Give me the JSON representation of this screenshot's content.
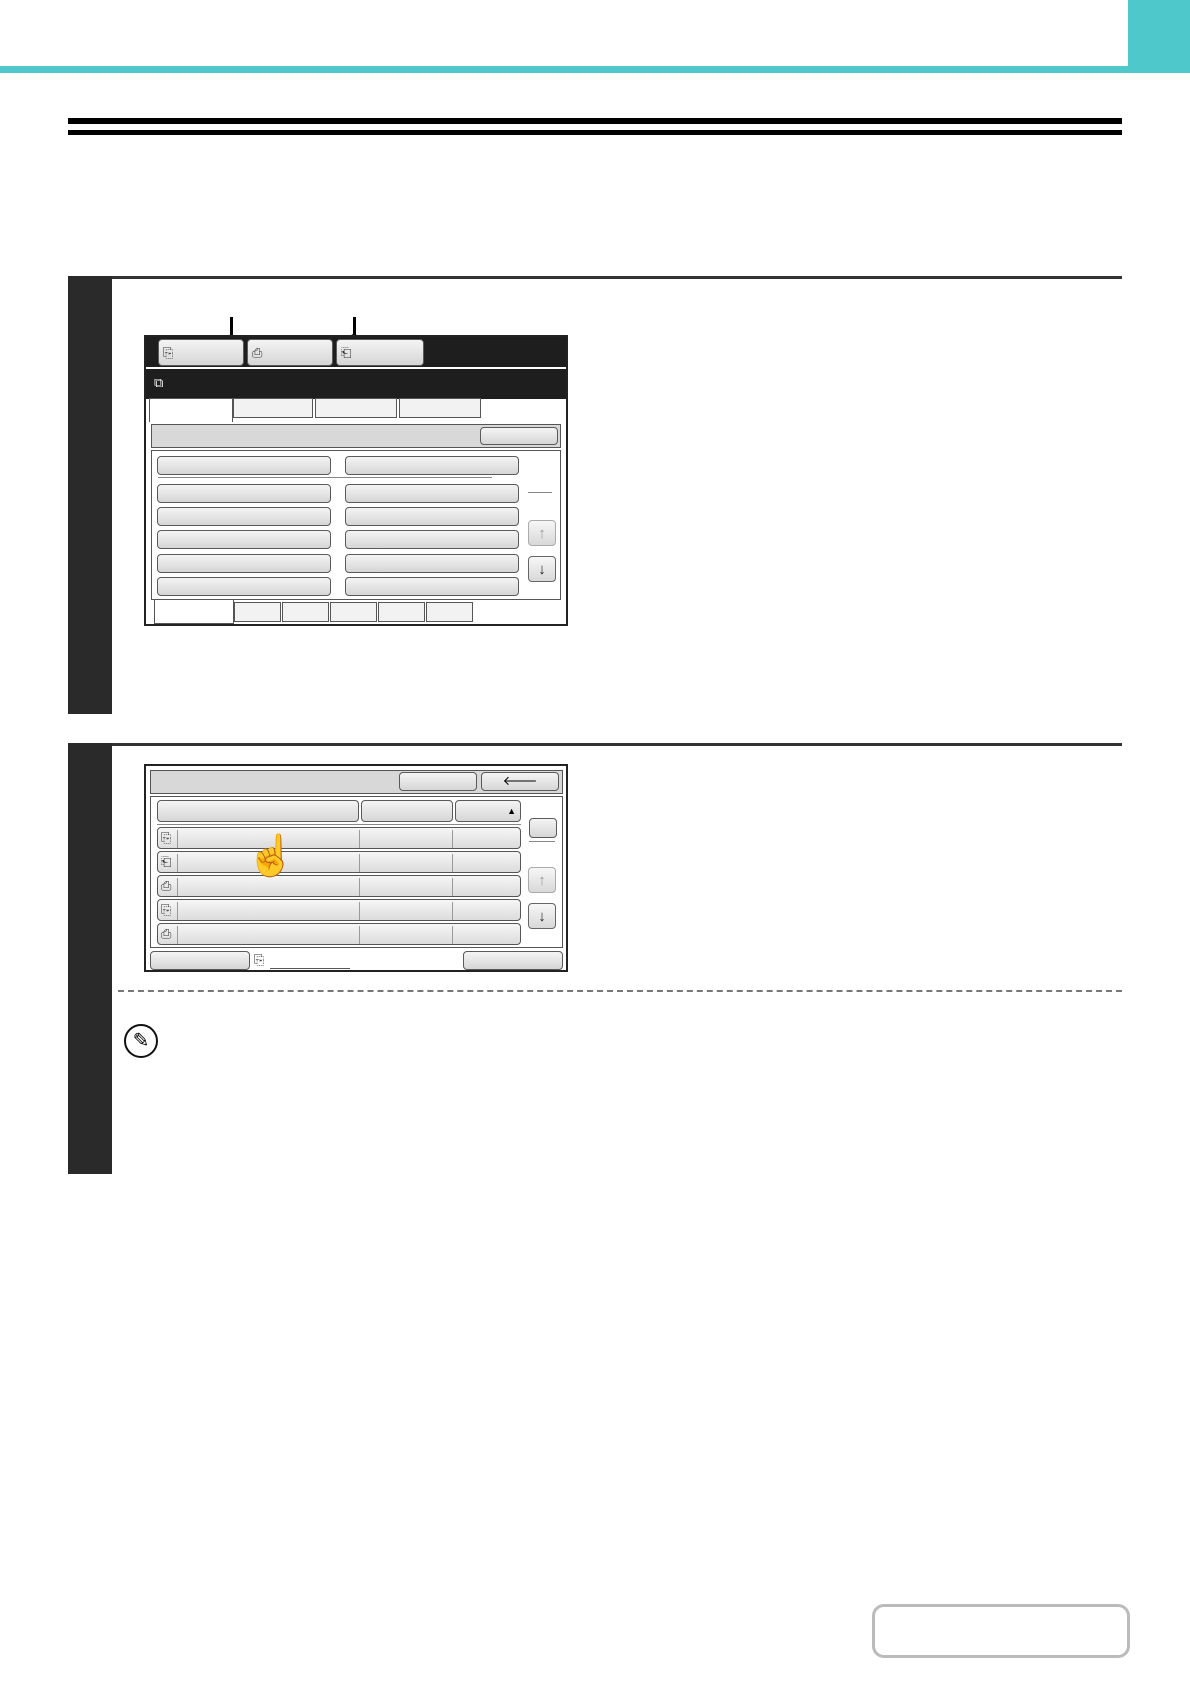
{
  "page": {
    "accent_color": "#4fc8cc",
    "navigation_box_label": ""
  },
  "step1": {
    "screen": {
      "mode_tabs": [
        "",
        "",
        ""
      ],
      "mode_tab_icons": [
        "copy-icon",
        "print-icon",
        "scan-icon"
      ],
      "title_icon": "job-status-icon",
      "tabs": [
        "",
        "",
        "",
        ""
      ],
      "header_button": "",
      "list_left": [
        "",
        "",
        "",
        "",
        "",
        ""
      ],
      "list_right": [
        "",
        "",
        "",
        "",
        "",
        ""
      ],
      "bottom_tabs": [
        "",
        "",
        "",
        "",
        "",
        ""
      ]
    }
  },
  "step2": {
    "screen": {
      "header_buttons": [
        "",
        "back-arrow-icon"
      ],
      "columns": [
        "",
        "",
        "▲"
      ],
      "rows": [
        {
          "icon": "copy-job-icon"
        },
        {
          "icon": "scan-job-icon"
        },
        {
          "icon": "fax-job-icon"
        },
        {
          "icon": "copy-job-icon"
        },
        {
          "icon": "fax-job-icon"
        }
      ],
      "footer_left": "",
      "footer_right": ""
    }
  }
}
